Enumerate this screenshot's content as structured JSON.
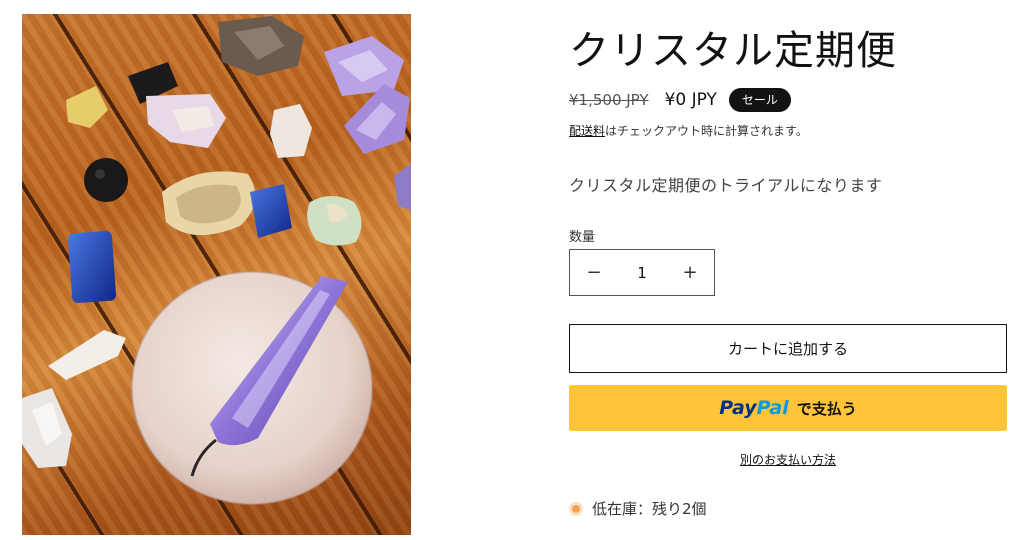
{
  "product": {
    "title": "クリスタル定期便",
    "price_original": "¥1,500 JPY",
    "price_current": "¥0 JPY",
    "sale_badge": "セール",
    "shipping_link": "配送料",
    "shipping_text": "はチェックアウト時に計算されます。",
    "description": "クリスタル定期便のトライアルになります",
    "image_alt": "crystal pendants on wooden table"
  },
  "quantity": {
    "label": "数量",
    "value": "1",
    "minus_glyph": "−",
    "plus_glyph": "+"
  },
  "buttons": {
    "add_to_cart": "カートに追加する",
    "paypal_brand_1": "Pay",
    "paypal_brand_2": "Pal",
    "paypal_text": "で支払う",
    "more_payment": "別のお支払い方法"
  },
  "stock": {
    "text": "低在庫：残り2個",
    "dot_color": "#f0a050"
  },
  "colors": {
    "paypal_yellow": "#ffc439",
    "badge_bg": "#121212"
  }
}
